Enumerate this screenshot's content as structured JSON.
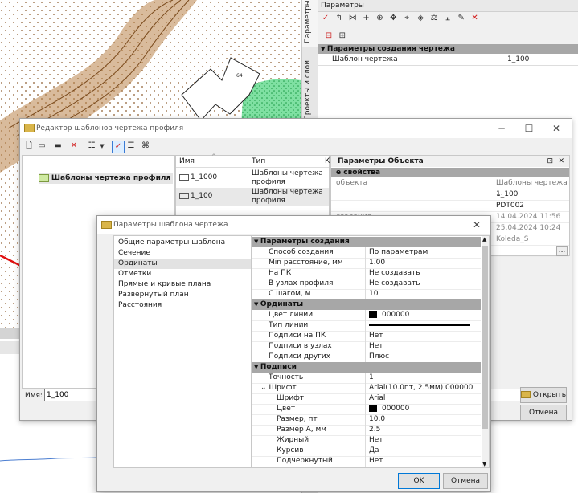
{
  "right_panel": {
    "vtab_params": "Параметры",
    "vtab_layers": "Проекты и слои",
    "title": "Параметры",
    "section": "Параметры создания чертежа",
    "prop_label": "Шаблон чертежа",
    "prop_value": "1_100"
  },
  "map": {
    "lot_label": "64"
  },
  "editor": {
    "title": "Редактор шаблонов чертежа профиля",
    "tree_root": "Шаблоны чертежа профиля",
    "list_headers": {
      "name": "Имя",
      "type": "Тип",
      "third": "К"
    },
    "rows": [
      {
        "name": "1_1000",
        "type": "Шаблоны чертежа профиля"
      },
      {
        "name": "1_100",
        "type": "Шаблоны чертежа профиля"
      }
    ],
    "obj_panel_title": "Параметры Объекта",
    "obj_section": "е свойства",
    "obj_rows": [
      {
        "name": "объекта",
        "value": "Шаблоны чертежа ..."
      },
      {
        "name": "",
        "value": "1_100"
      },
      {
        "name": "",
        "value": "PDT002"
      },
      {
        "name": "создания",
        "value": "14.04.2024 11:56"
      },
      {
        "name": "",
        "value": "25.04.2024 10:24"
      },
      {
        "name": "",
        "value": "Koleda_S"
      },
      {
        "name": "",
        "value": ""
      }
    ],
    "name_label": "Имя:",
    "name_value": "1_100",
    "open_button": "Открыть",
    "cancel_button": "Отмена",
    "ellipsis": "..."
  },
  "dialog": {
    "title": "Параметры шаблона чертежа",
    "nav": [
      "Общие параметры шаблона",
      "Сечение",
      "Ординаты",
      "Отметки",
      "Прямые и кривые плана",
      "Развёрнутый план",
      "Расстояния"
    ],
    "nav_selected": 2,
    "sections": [
      {
        "title": "Параметры создания",
        "rows": [
          {
            "name": "Способ создания",
            "value": "По параметрам"
          },
          {
            "name": "Min расстояние, мм",
            "value": "1.00"
          },
          {
            "name": "На ПК",
            "value": "Не создавать"
          },
          {
            "name": "В узлах профиля",
            "value": "Не создавать"
          },
          {
            "name": "С шагом, м",
            "value": "10"
          }
        ]
      },
      {
        "title": "Ординаты",
        "rows": [
          {
            "name": "Цвет линии",
            "value": "000000",
            "swatch": "#000000"
          },
          {
            "name": "Тип линии",
            "value": "",
            "line": true
          },
          {
            "name": "Подписи на ПК",
            "value": "Нет"
          },
          {
            "name": "Подписи в узлах",
            "value": "Нет"
          },
          {
            "name": "Подписи других",
            "value": "Плюс"
          }
        ]
      },
      {
        "title": "Подписи",
        "rows": [
          {
            "name": "Точность",
            "value": "1"
          },
          {
            "name": "Шрифт",
            "value": "Arial(10.0пт, 2.5мм) 000000",
            "expand": "⌄"
          },
          {
            "name": "Шрифт",
            "value": "Arial",
            "sub": true
          },
          {
            "name": "Цвет",
            "value": "000000",
            "sub": true,
            "swatch": "#000000"
          },
          {
            "name": "Размер, пт",
            "value": "10.0",
            "sub": true
          },
          {
            "name": "Размер А, мм",
            "value": "2.5",
            "sub": true
          },
          {
            "name": "Жирный",
            "value": "Нет",
            "sub": true
          },
          {
            "name": "Курсив",
            "value": "Да",
            "sub": true
          },
          {
            "name": "Подчеркнутый",
            "value": "Нет",
            "sub": true
          }
        ]
      }
    ],
    "ok": "OK",
    "cancel": "Отмена"
  },
  "colors": {
    "accent": "#0078d7",
    "header": "#a7a7a7",
    "contour": "#8b5a2b",
    "green": "#33cc66"
  }
}
